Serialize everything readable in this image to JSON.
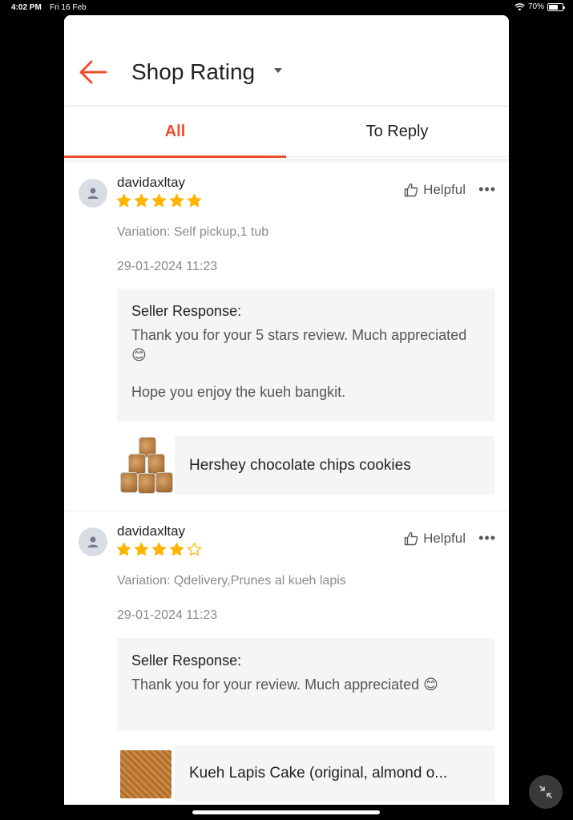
{
  "status_bar": {
    "time": "4:02 PM",
    "date": "Fri 16 Feb",
    "battery": "70%",
    "battery_level": 0.7
  },
  "header": {
    "title": "Shop Rating"
  },
  "tabs": [
    {
      "label": "All",
      "active": true
    },
    {
      "label": "To Reply",
      "active": false
    }
  ],
  "reviews": [
    {
      "username": "davidaxltay",
      "rating": 5,
      "helpful_label": "Helpful",
      "variation": "Variation: Self pickup,1 tub",
      "date": "29-01-2024 11:23",
      "seller_response_label": "Seller Response:",
      "response_line1": "Thank you for your 5 stars review. Much appreciated 😊",
      "response_line2": "Hope you enjoy the kueh bangkit.",
      "product_name": "Hershey chocolate chips cookies"
    },
    {
      "username": "davidaxltay",
      "rating": 4,
      "helpful_label": "Helpful",
      "variation": "Variation: Qdelivery,Prunes al kueh lapis",
      "date": "29-01-2024 11:23",
      "seller_response_label": "Seller Response:",
      "response_line1": "Thank you for your review. Much appreciated 😊",
      "product_name": "Kueh Lapis Cake (original, almond o..."
    }
  ],
  "colors": {
    "accent": "#ee4d2d",
    "star": "#ffb400",
    "background": "#f5f5f5"
  },
  "icons": {
    "back": "back-arrow-icon",
    "dropdown": "caret-down-icon",
    "helpful": "thumbs-up-icon",
    "more": "more-dots-icon",
    "minimize": "minimize-icon"
  }
}
